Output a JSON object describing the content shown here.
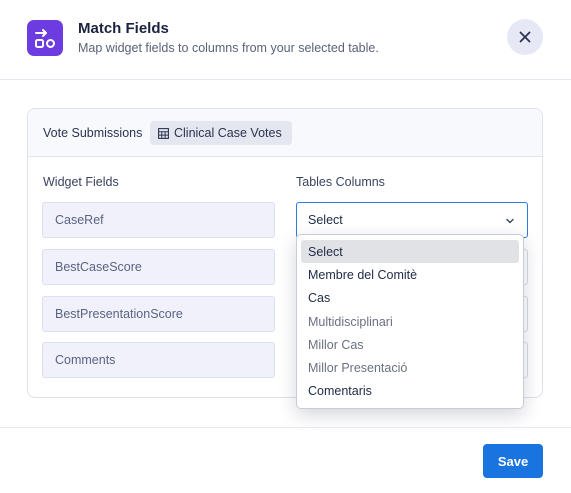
{
  "header": {
    "title": "Match Fields",
    "subtitle": "Map widget fields to columns from your selected table.",
    "icon": "match-fields-icon",
    "icon_color": "#6d3ce0"
  },
  "source": {
    "label": "Vote Submissions",
    "table_name": "Clinical Case Votes"
  },
  "columns": {
    "widget_header": "Widget Fields",
    "table_header": "Tables Columns"
  },
  "fields": [
    {
      "name": "CaseRef"
    },
    {
      "name": "BestCaseScore"
    },
    {
      "name": "BestPresentationScore"
    },
    {
      "name": "Comments"
    }
  ],
  "active_select": {
    "value": "Select"
  },
  "dropdown": {
    "options": [
      {
        "label": "Select",
        "state": "selected"
      },
      {
        "label": "Membre del Comitè",
        "state": "normal"
      },
      {
        "label": "Cas",
        "state": "normal"
      },
      {
        "label": "Multidisciplinari",
        "state": "muted"
      },
      {
        "label": "Millor Cas",
        "state": "muted"
      },
      {
        "label": "Millor Presentació",
        "state": "muted"
      },
      {
        "label": "Comentaris",
        "state": "normal"
      }
    ]
  },
  "footer": {
    "save_label": "Save",
    "accent": "#1a74e0"
  }
}
